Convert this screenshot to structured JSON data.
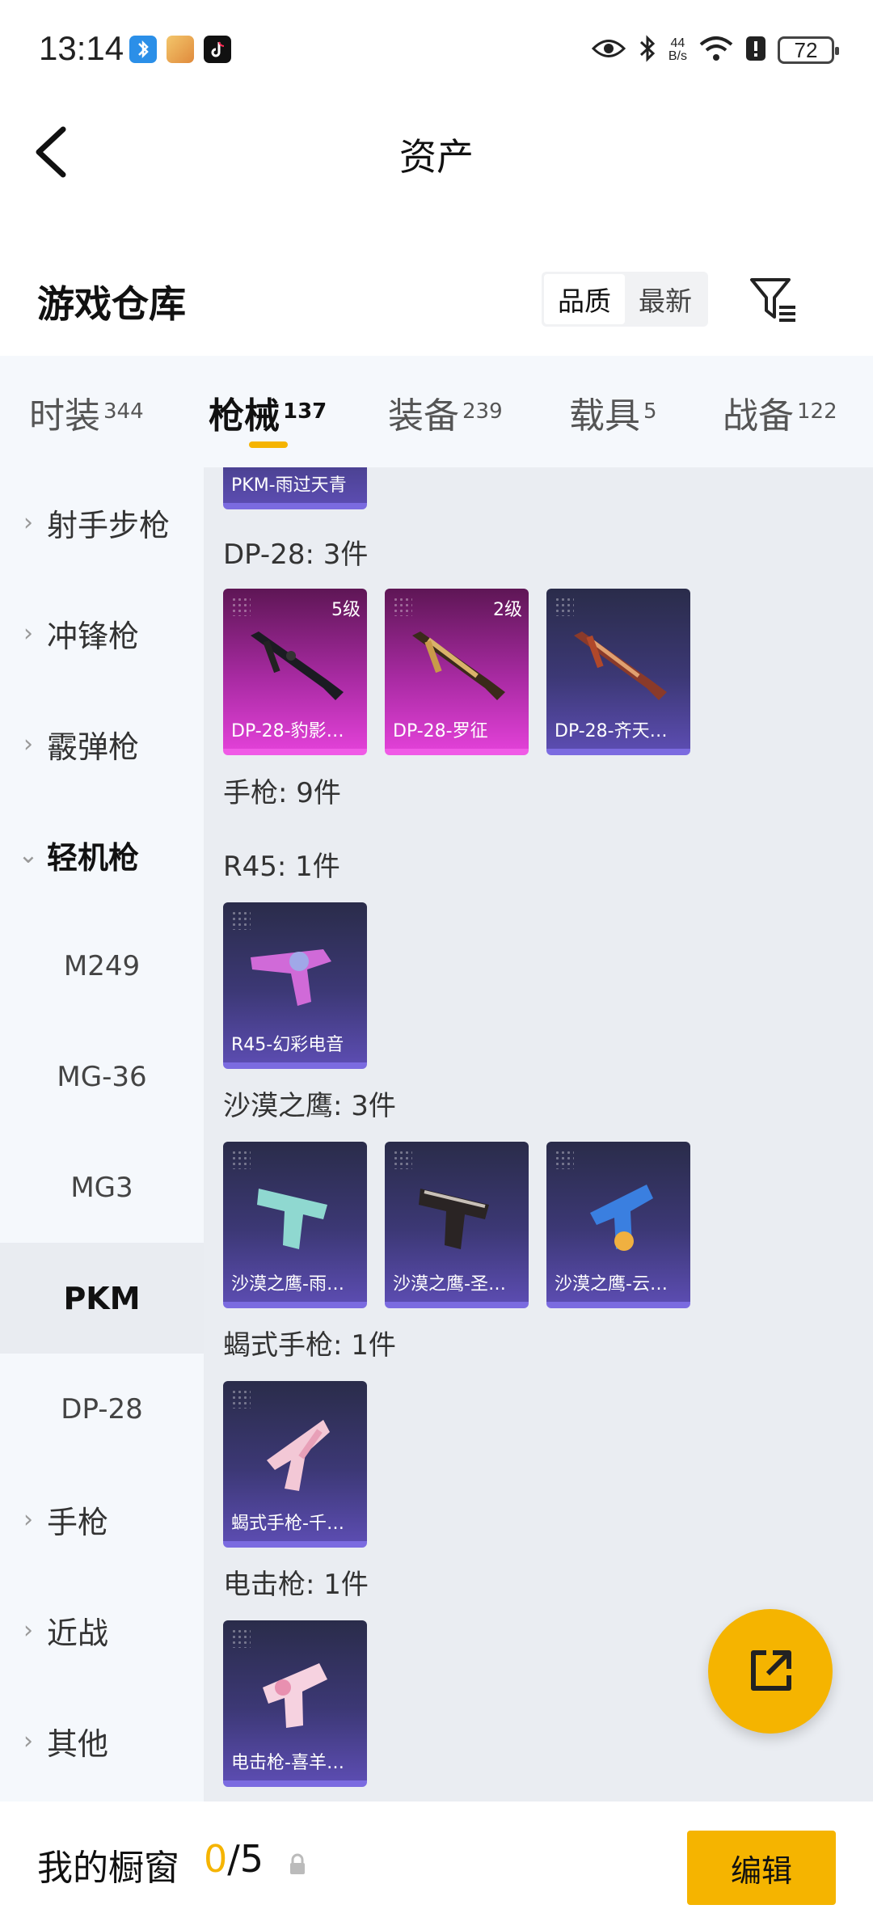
{
  "status_bar": {
    "time": "13:14",
    "net_speed_value": "44",
    "net_speed_unit": "B/s",
    "battery": "72",
    "icons": [
      "bluetooth-app-icon",
      "game-app-icon",
      "tiktok-icon",
      "eye-icon",
      "bluetooth-icon",
      "wifi-icon",
      "alert-icon",
      "battery-icon"
    ]
  },
  "nav": {
    "title": "资产"
  },
  "warehouse": {
    "title": "游戏仓库",
    "sort_options": [
      "品质",
      "最新"
    ],
    "sort_selected": "品质"
  },
  "tabs": [
    {
      "label": "时装",
      "count": "344"
    },
    {
      "label": "枪械",
      "count": "137"
    },
    {
      "label": "装备",
      "count": "239"
    },
    {
      "label": "载具",
      "count": "5"
    },
    {
      "label": "战备",
      "count": "122"
    }
  ],
  "active_tab": "枪械",
  "sidebar": {
    "items": [
      {
        "label": "射手步枪",
        "chevron": "›"
      },
      {
        "label": "冲锋枪",
        "chevron": "›"
      },
      {
        "label": "霰弹枪",
        "chevron": "›"
      },
      {
        "label": "轻机枪",
        "chevron": "⌄"
      },
      {
        "label": "M249"
      },
      {
        "label": "MG-36"
      },
      {
        "label": "MG3"
      },
      {
        "label": "PKM"
      },
      {
        "label": "DP-28"
      },
      {
        "label": "手枪",
        "chevron": "›"
      },
      {
        "label": "近战",
        "chevron": "›"
      },
      {
        "label": "其他",
        "chevron": "›"
      }
    ],
    "selected": "PKM"
  },
  "content": {
    "partial_card_label": "PKM-雨过天青",
    "sections": [
      {
        "title": "DP-28: 3件",
        "cards": [
          {
            "label": "DP-28-豹影…",
            "level": "5级",
            "rarity": "pink"
          },
          {
            "label": "DP-28-罗征",
            "level": "2级",
            "rarity": "pink"
          },
          {
            "label": "DP-28-齐天…",
            "level": "",
            "rarity": "purple"
          }
        ]
      },
      {
        "title": "手枪: 9件",
        "cards": []
      },
      {
        "title": "R45: 1件",
        "cards": [
          {
            "label": "R45-幻彩电音",
            "level": "",
            "rarity": "purple"
          }
        ]
      },
      {
        "title": "沙漠之鹰: 3件",
        "cards": [
          {
            "label": "沙漠之鹰-雨…",
            "level": "",
            "rarity": "purple"
          },
          {
            "label": "沙漠之鹰-圣…",
            "level": "",
            "rarity": "purple"
          },
          {
            "label": "沙漠之鹰-云…",
            "level": "",
            "rarity": "purple"
          }
        ]
      },
      {
        "title": "蝎式手枪: 1件",
        "cards": [
          {
            "label": "蝎式手枪-千…",
            "level": "",
            "rarity": "purple"
          }
        ]
      },
      {
        "title": "电击枪: 1件",
        "cards": [
          {
            "label": "电击枪-喜羊…",
            "level": "",
            "rarity": "purple"
          }
        ]
      }
    ]
  },
  "bottom_bar": {
    "label": "我的橱窗",
    "current": "0",
    "total": "/5",
    "edit_label": "编辑"
  },
  "colors": {
    "accent": "#f5b400",
    "rarity_purple": "#5b4cb0",
    "rarity_pink": "#e040d6"
  }
}
